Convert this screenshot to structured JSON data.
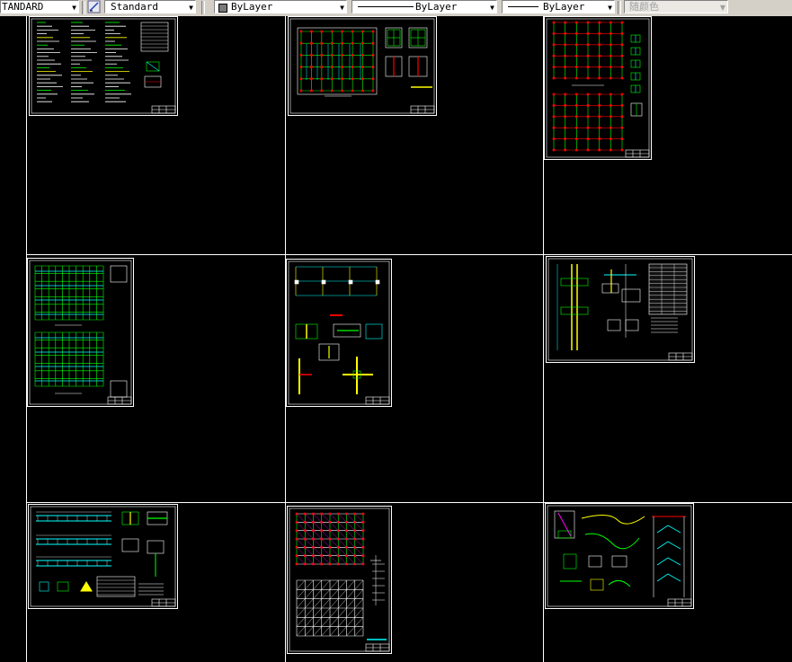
{
  "toolbar": {
    "text_style": "TANDARD",
    "dim_style_icon": "dimstyle-icon",
    "dim_style": "Standard",
    "layer_color_swatch": "#7a7a7a",
    "color": "ByLayer",
    "linetype": "ByLayer",
    "lineweight": "ByLayer",
    "plot_style": "随颜色"
  },
  "colors": {
    "background": "#000000",
    "cad_white": "#ffffff",
    "cad_green": "#00ff00",
    "cad_red": "#ff0000",
    "cad_yellow": "#ffff00",
    "cad_cyan": "#00ffff",
    "cad_magenta": "#ff00ff"
  },
  "sheets": [
    {
      "id": "sheet-1",
      "kind": "notes",
      "label": "structural design notes sheet"
    },
    {
      "id": "sheet-2",
      "kind": "plan",
      "label": "foundation plan sheet"
    },
    {
      "id": "sheet-3",
      "kind": "grid",
      "label": "column grid plans sheet"
    },
    {
      "id": "sheet-4",
      "kind": "double-plan",
      "label": "floor framing plans sheet"
    },
    {
      "id": "sheet-5",
      "kind": "details",
      "label": "joint details sheet"
    },
    {
      "id": "sheet-6",
      "kind": "column",
      "label": "column elevation sheet"
    },
    {
      "id": "sheet-7",
      "kind": "beams",
      "label": "beam details sheet"
    },
    {
      "id": "sheet-8",
      "kind": "roof",
      "label": "roof framing plan sheet"
    },
    {
      "id": "sheet-9",
      "kind": "stair",
      "label": "stair details sheet"
    }
  ]
}
